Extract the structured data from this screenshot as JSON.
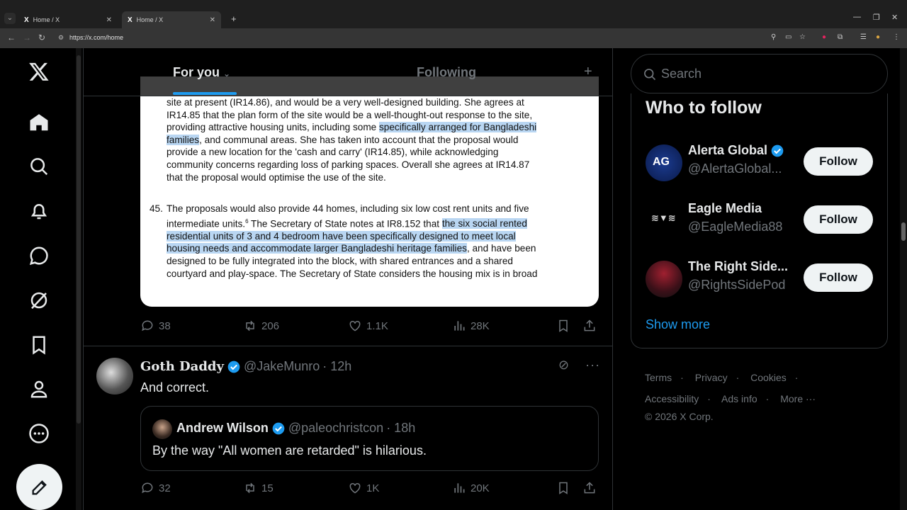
{
  "browser": {
    "tabs": [
      {
        "title": "Home / X",
        "active": false
      },
      {
        "title": "Home / X",
        "active": true
      }
    ],
    "url": "https://x.com/home"
  },
  "timeline": {
    "tabs": {
      "for_you": "For you",
      "following": "Following"
    }
  },
  "document": {
    "p1_lines": [
      "site at present (IR14.86), and would be a very well-designed building. She agrees at",
      "IR14.85 that the plan form of the site would be a well-thought-out response to the site,",
      "providing attractive housing units, including some ",
      "specifically arranged for Bangladeshi",
      "families",
      ", and communal areas. She has taken into account that the proposal would",
      "provide a new location for the 'cash and carry' (IR14.85), while acknowledging",
      "community concerns regarding loss of parking spaces. Overall she agrees at IR14.87",
      "that the proposal would optimise the use of the site."
    ],
    "p2_number": "45.",
    "p2_lines": [
      "The proposals would also provide 44 homes, including six low cost rent units and five",
      "intermediate units.",
      "6",
      " The Secretary of State notes at IR8.152 that ",
      "the six social rented",
      "residential units of 3 and 4 bedroom have been specifically designed to meet local",
      "housing needs and accommodate larger Bangladeshi heritage families",
      ", and have been",
      "designed to be fully integrated into the block, with shared entrances and a shared",
      "courtyard and play-space. The Secretary of State considers the housing mix is in broad"
    ]
  },
  "post1_stats": {
    "replies": "38",
    "reposts": "206",
    "likes": "1.1K",
    "views": "28K"
  },
  "post2": {
    "author": "Goth Daddy",
    "handle": "@JakeMunro",
    "time": "· 12h",
    "text": "And correct.",
    "quote": {
      "author": "Andrew Wilson",
      "handle": "@paleochristcon",
      "time": "· 18h",
      "text": "By the way \"All women are retarded\" is hilarious."
    },
    "stats": {
      "replies": "32",
      "reposts": "15",
      "likes": "1K",
      "views": "20K"
    }
  },
  "search": {
    "placeholder": "Search"
  },
  "who_to_follow": {
    "title": "Who to follow",
    "accounts": [
      {
        "name": "Alerta Global",
        "handle": "@AlertaGlobal...",
        "verified": true,
        "button": "Follow"
      },
      {
        "name": "Eagle Media",
        "handle": "@EagleMedia88",
        "verified": false,
        "button": "Follow"
      },
      {
        "name": "The Right Side...",
        "handle": "@RightsSidePod",
        "verified": false,
        "button": "Follow"
      }
    ],
    "show_more": "Show more"
  },
  "footer": {
    "links": [
      "Terms",
      "Privacy",
      "Cookies",
      "Accessibility",
      "Ads info",
      "More ···"
    ],
    "copyright": "© 2026 X Corp."
  },
  "colors": {
    "accent": "#1d9bf0",
    "background": "#000000",
    "muted": "#71767b",
    "highlight": "#b9d6f2"
  }
}
